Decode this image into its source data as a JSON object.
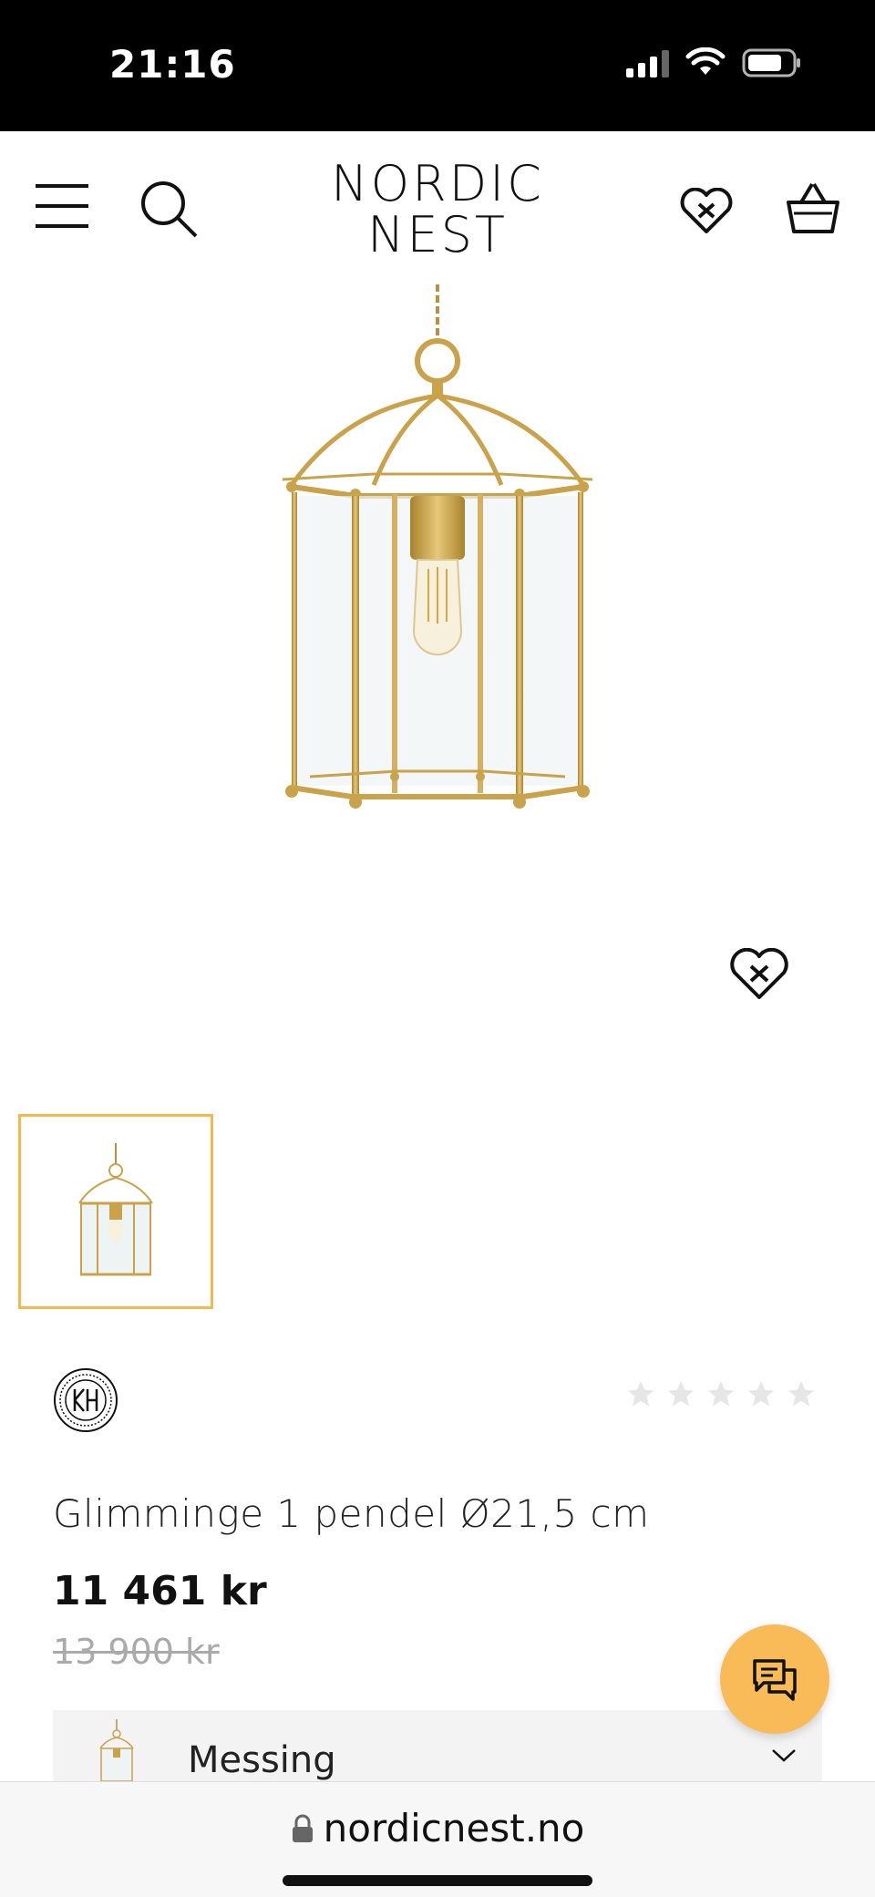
{
  "status_bar": {
    "time": "21:16",
    "icons": [
      "signal-icon",
      "wifi-icon",
      "battery-icon"
    ]
  },
  "header": {
    "logo_line1": "NORDIC",
    "logo_line2": "NEST",
    "icons": [
      "menu-icon",
      "search-icon",
      "wishlist-icon",
      "basket-icon"
    ]
  },
  "product": {
    "title": "Glimminge 1 pendel Ø21,5 cm",
    "price": "11 461 kr",
    "old_price": "13 900 kr",
    "rating_stars": 5,
    "rating_value": 0,
    "brand_logo_text": "KH"
  },
  "variant": {
    "label": "Messing"
  },
  "browser": {
    "url": "nordicnest.no"
  },
  "colors": {
    "accent": "#f6b84a",
    "chat_button": "#f9bb57",
    "brass": "#c9a24a",
    "star_empty": "#e6e6e6"
  }
}
